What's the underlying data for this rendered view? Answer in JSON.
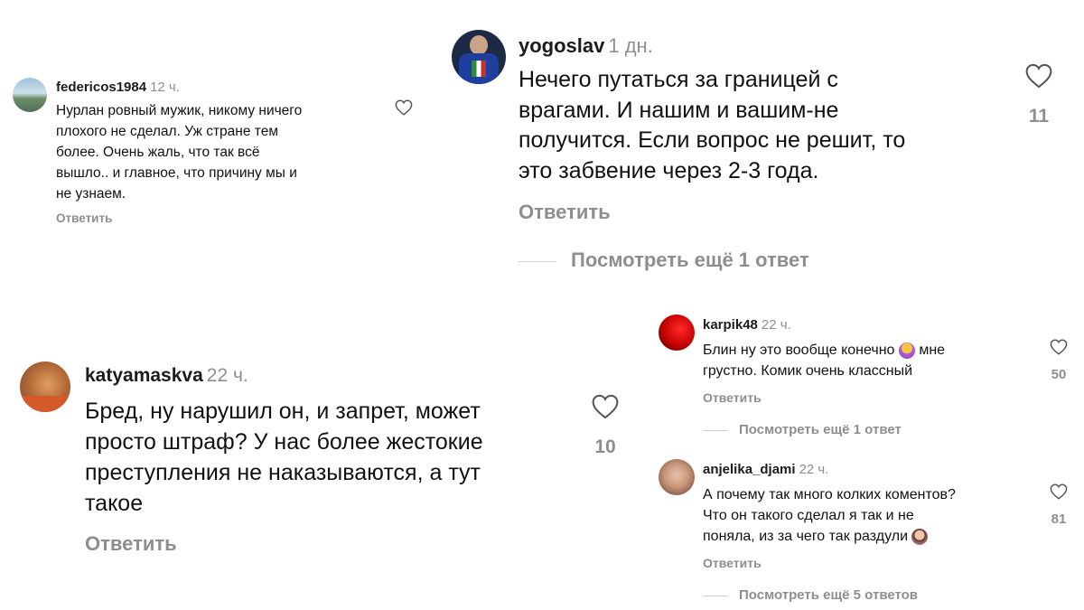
{
  "comments": [
    {
      "username": "federicos1984",
      "time": "12 ч.",
      "text": "Нурлан ровный мужик, никому ничего\nплохого не сделал. Уж стране тем\nболее. Очень жаль, что так всё\nвышло.. и главное, что причину мы и\nне узнаем.",
      "reply": "Ответить"
    },
    {
      "username": "yogoslav",
      "time": "1 дн.",
      "text": "Нечего путаться за границей с\nврагами. И нашим и вашим-не\nполучится. Если вопрос не решит, то\nэто забвение через 2-3 года.",
      "reply": "Ответить",
      "likes": "11",
      "more_replies": "Посмотреть ещё 1 ответ"
    },
    {
      "username": "katyamaskva",
      "time": "22 ч.",
      "text": "Бред, ну нарушил он, и запрет, может\nпросто штраф?  У нас более жестокие\nпреступления не наказываются, а тут\nтакое",
      "reply": "Ответить",
      "likes": "10"
    },
    {
      "username": "karpik48",
      "time": "22 ч.",
      "text_before_emoji": "Блин ну это вообще конечно ",
      "text_after_emoji": " мне\nгрустно. Комик очень классный",
      "emoji": "shrug-emoji",
      "reply": "Ответить",
      "likes": "50",
      "more_replies": "Посмотреть ещё 1 ответ"
    },
    {
      "username": "anjelika_djami",
      "time": "22 ч.",
      "text": "А почему так много колких коментов?\nЧто он такого сделал я так и не\nпоняла, из за чего так раздули ",
      "emoji": "facepalm-emoji",
      "reply": "Ответить",
      "likes": "81",
      "more_replies": "Посмотреть ещё 5 ответов"
    }
  ],
  "colors": {
    "text": "#111111",
    "muted": "#8e8e8e",
    "heart_stroke": "#555555"
  }
}
